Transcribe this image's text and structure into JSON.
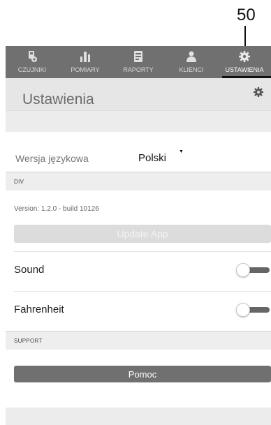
{
  "callout": {
    "number": "50"
  },
  "tabs": [
    {
      "label": "CZUJNIKI",
      "icon": "sensor-icon"
    },
    {
      "label": "POMIARY",
      "icon": "bar-chart-icon"
    },
    {
      "label": "RAPORTY",
      "icon": "report-icon"
    },
    {
      "label": "KLIENCI",
      "icon": "clients-icon"
    },
    {
      "label": "USTAWIENIA",
      "icon": "settings-icon",
      "active": true
    }
  ],
  "header": {
    "title": "Ustawienia",
    "icon": "gear-icon"
  },
  "language": {
    "label": "Wersja językowa",
    "value": "Polski",
    "caret": "▼"
  },
  "div_section": {
    "heading": "DIV",
    "version_text": "Version: 1.2.0 - build 10126",
    "update_label": "Update App"
  },
  "toggles": [
    {
      "label": "Sound",
      "on": false
    },
    {
      "label": "Fahrenheit",
      "on": false
    }
  ],
  "support_section": {
    "heading": "SUPPORT",
    "button_label": "Pomoc"
  },
  "colors": {
    "tabbar": "#707070",
    "header_bg": "#e6e6e6",
    "toggle_track": "#666666",
    "support_button": "#707070",
    "update_button": "#dcdcdc"
  }
}
